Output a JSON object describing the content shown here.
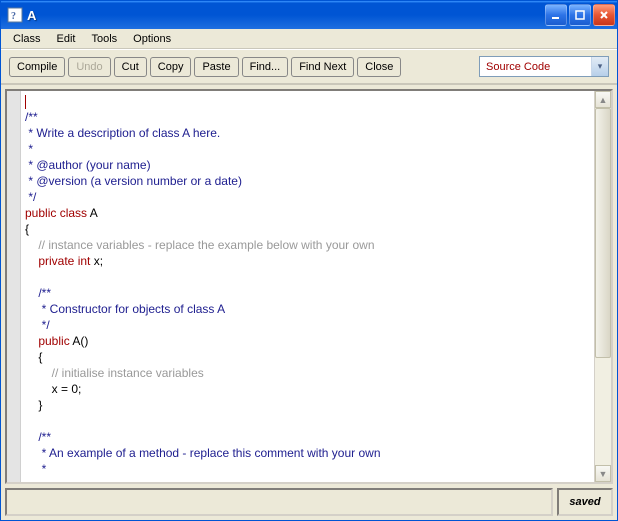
{
  "window": {
    "title": "A"
  },
  "menu": {
    "class": "Class",
    "edit": "Edit",
    "tools": "Tools",
    "options": "Options"
  },
  "toolbar": {
    "compile": "Compile",
    "undo": "Undo",
    "cut": "Cut",
    "copy": "Copy",
    "paste": "Paste",
    "find": "Find...",
    "findnext": "Find Next",
    "close": "Close"
  },
  "view_selector": {
    "selected": "Source Code"
  },
  "code": {
    "l1": "",
    "l2": "/**",
    "l3": " * Write a description of class A here.",
    "l4": " * ",
    "l5": " * @author (your name) ",
    "l6": " * @version (a version number or a date)",
    "l7": " */",
    "l8a": "public",
    "l8b": " class",
    "l8c": " A",
    "l9": "{",
    "l10": "    // instance variables - replace the example below with your own",
    "l11a": "    private",
    "l11b": " int",
    "l11c": " x;",
    "l12": "",
    "l13": "    /**",
    "l14": "     * Constructor for objects of class A",
    "l15": "     */",
    "l16a": "    public",
    "l16b": " A()",
    "l17": "    {",
    "l18": "        // initialise instance variables",
    "l19": "        x = 0;",
    "l20": "    }",
    "l21": "",
    "l22": "    /**",
    "l23": "     * An example of a method - replace this comment with your own",
    "l24": "     * "
  },
  "status": {
    "state": "saved"
  }
}
